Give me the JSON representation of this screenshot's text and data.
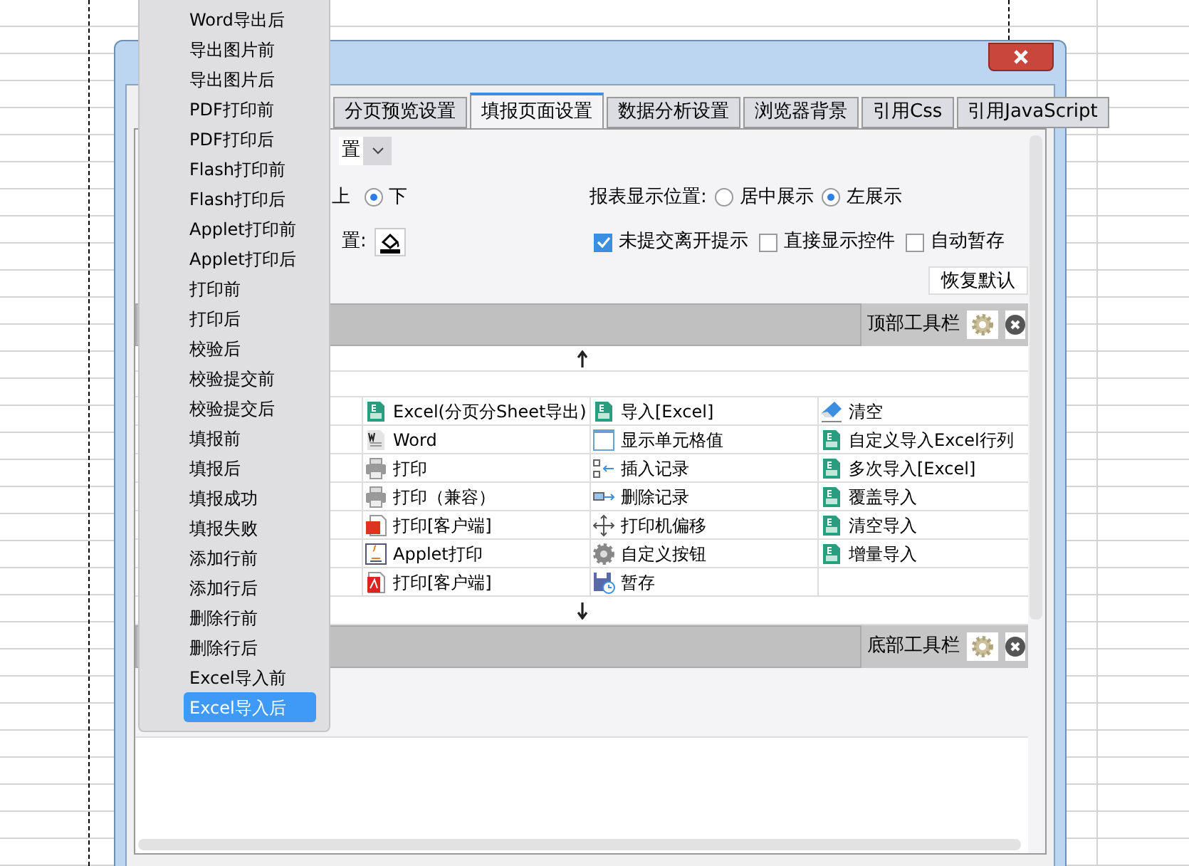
{
  "tabs": [
    {
      "label": "分页预览设置",
      "selected": false
    },
    {
      "label": "填报页面设置",
      "selected": true
    },
    {
      "label": "数据分析设置",
      "selected": false
    },
    {
      "label": "浏览器背景",
      "selected": false
    },
    {
      "label": "引用Css",
      "selected": false
    },
    {
      "label": "引用JavaScript",
      "selected": false
    }
  ],
  "settings_dropdown": {
    "value": "置"
  },
  "toolbar_position": {
    "up_label": "上",
    "down": {
      "label": "下",
      "selected": true
    }
  },
  "report_position": {
    "label": "报表显示位置:",
    "options": [
      {
        "label": "居中展示",
        "selected": false
      },
      {
        "label": "左展示",
        "selected": true
      }
    ]
  },
  "background_label": "置:",
  "checkboxes": [
    {
      "label": "未提交离开提示",
      "checked": true
    },
    {
      "label": "直接显示控件",
      "checked": false
    },
    {
      "label": "自动暂存",
      "checked": false
    }
  ],
  "restore_button": "恢复默认",
  "top_toolbar": {
    "label": "顶部工具栏"
  },
  "bottom_toolbar": {
    "label": "底部工具栏"
  },
  "button_grid": [
    [
      {
        "label": "Excel(分页分Sheet导出)",
        "kind": "excel"
      },
      {
        "label": "导入[Excel]",
        "kind": "excel"
      },
      {
        "label": "清空",
        "kind": "eraser"
      }
    ],
    [
      {
        "label": "Word",
        "kind": "word"
      },
      {
        "label": "显示单元格值",
        "kind": "cell"
      },
      {
        "label": "自定义导入Excel行列",
        "kind": "excel"
      }
    ],
    [
      {
        "label": "打印",
        "kind": "printer"
      },
      {
        "label": "插入记录",
        "kind": "insert"
      },
      {
        "label": "多次导入[Excel]",
        "kind": "excel"
      }
    ],
    [
      {
        "label": "打印（兼容）",
        "kind": "printer"
      },
      {
        "label": "删除记录",
        "kind": "delete"
      },
      {
        "label": "覆盖导入",
        "kind": "excel"
      }
    ],
    [
      {
        "label": "打印[客户端]",
        "kind": "flash"
      },
      {
        "label": "打印机偏移",
        "kind": "move"
      },
      {
        "label": "清空导入",
        "kind": "excel"
      }
    ],
    [
      {
        "label": "Applet打印",
        "kind": "applet"
      },
      {
        "label": "自定义按钮",
        "kind": "gear"
      },
      {
        "label": "增量导入",
        "kind": "excel"
      }
    ],
    [
      {
        "label": "打印[客户端]",
        "kind": "pdf"
      },
      {
        "label": "暂存",
        "kind": "save"
      }
    ]
  ],
  "event_menu": {
    "items": [
      {
        "label": "Word导出后",
        "selected": false
      },
      {
        "label": "导出图片前",
        "selected": false
      },
      {
        "label": "导出图片后",
        "selected": false
      },
      {
        "label": "PDF打印前",
        "selected": false
      },
      {
        "label": "PDF打印后",
        "selected": false
      },
      {
        "label": "Flash打印前",
        "selected": false
      },
      {
        "label": "Flash打印后",
        "selected": false
      },
      {
        "label": "Applet打印前",
        "selected": false
      },
      {
        "label": "Applet打印后",
        "selected": false
      },
      {
        "label": "打印前",
        "selected": false
      },
      {
        "label": "打印后",
        "selected": false
      },
      {
        "label": "校验后",
        "selected": false
      },
      {
        "label": "校验提交前",
        "selected": false
      },
      {
        "label": "校验提交后",
        "selected": false
      },
      {
        "label": "填报前",
        "selected": false
      },
      {
        "label": "填报后",
        "selected": false
      },
      {
        "label": "填报成功",
        "selected": false
      },
      {
        "label": "填报失败",
        "selected": false
      },
      {
        "label": "添加行前",
        "selected": false
      },
      {
        "label": "添加行后",
        "selected": false
      },
      {
        "label": "删除行前",
        "selected": false
      },
      {
        "label": "删除行后",
        "selected": false
      },
      {
        "label": "Excel导入前",
        "selected": false
      },
      {
        "label": "Excel导入后",
        "selected": true
      }
    ]
  }
}
